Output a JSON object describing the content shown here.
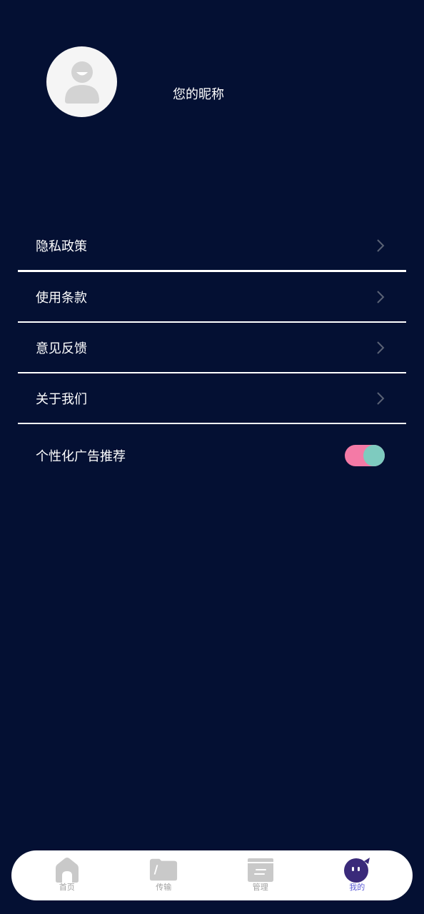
{
  "profile": {
    "nickname": "您的昵称",
    "avatar_icon": "user-icon"
  },
  "menu": {
    "items": [
      {
        "label": "隐私政策",
        "icon": "chevron-right-icon"
      },
      {
        "label": "使用条款",
        "icon": "chevron-right-icon"
      },
      {
        "label": "意见反馈",
        "icon": "chevron-right-icon"
      },
      {
        "label": "关于我们",
        "icon": "chevron-right-icon"
      }
    ],
    "toggle": {
      "label": "个性化广告推荐",
      "state": "on"
    }
  },
  "tabbar": {
    "tabs": [
      {
        "label": "首页",
        "icon": "home-icon",
        "active": false
      },
      {
        "label": "传输",
        "icon": "folder-icon",
        "active": false
      },
      {
        "label": "管理",
        "icon": "archive-icon",
        "active": false
      },
      {
        "label": "我的",
        "icon": "mascot-icon",
        "active": true
      }
    ]
  },
  "colors": {
    "background": "#041033",
    "toggle_track": "#f47aa6",
    "toggle_knob": "#7ecbbf",
    "active_tab": "#5b5bd6",
    "inactive_tab": "#a0a0a0"
  }
}
